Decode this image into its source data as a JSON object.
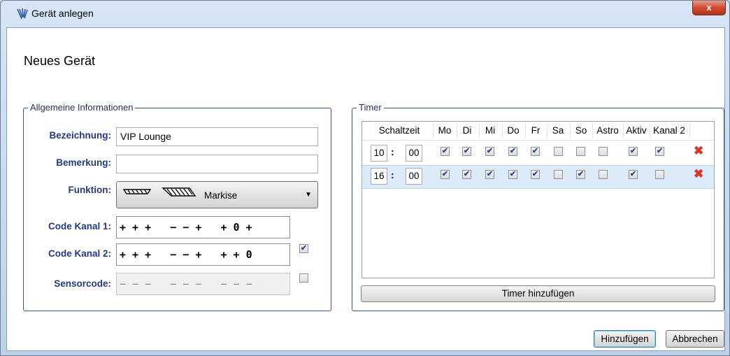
{
  "window": {
    "title": "Gerät anlegen",
    "close_label": "x"
  },
  "heading": "Neues Gerät",
  "general": {
    "legend": "Allgemeine Informationen",
    "bezeichnung_label": "Bezeichnung:",
    "bezeichnung_value": "VIP Lounge",
    "bemerkung_label": "Bemerkung:",
    "bemerkung_value": "",
    "funktion_label": "Funktion:",
    "funktion_value": "Markise",
    "code1_label": "Code Kanal 1:",
    "code1_value": "+ + +   − − +   + 0 +",
    "code2_label": "Code Kanal 2:",
    "code2_value": "+ + +   − − +   + + 0",
    "code2_enabled": true,
    "sensor_label": "Sensorcode:",
    "sensor_value": "− − −   − − −   − − −",
    "sensor_enabled": false
  },
  "timer": {
    "legend": "Timer",
    "columns": [
      "Schaltzeit",
      "Mo",
      "Di",
      "Mi",
      "Do",
      "Fr",
      "Sa",
      "So",
      "Astro",
      "Aktiv",
      "Kanal 2"
    ],
    "rows": [
      {
        "hour": "10",
        "minute": "00",
        "flags": [
          true,
          true,
          true,
          true,
          true,
          false,
          false,
          false,
          true,
          true
        ]
      },
      {
        "hour": "16",
        "minute": "00",
        "flags": [
          true,
          true,
          true,
          true,
          true,
          false,
          true,
          false,
          true,
          false
        ]
      }
    ],
    "add_button": "Timer hinzufügen"
  },
  "buttons": {
    "add": "Hinzufügen",
    "cancel": "Abbrechen"
  }
}
